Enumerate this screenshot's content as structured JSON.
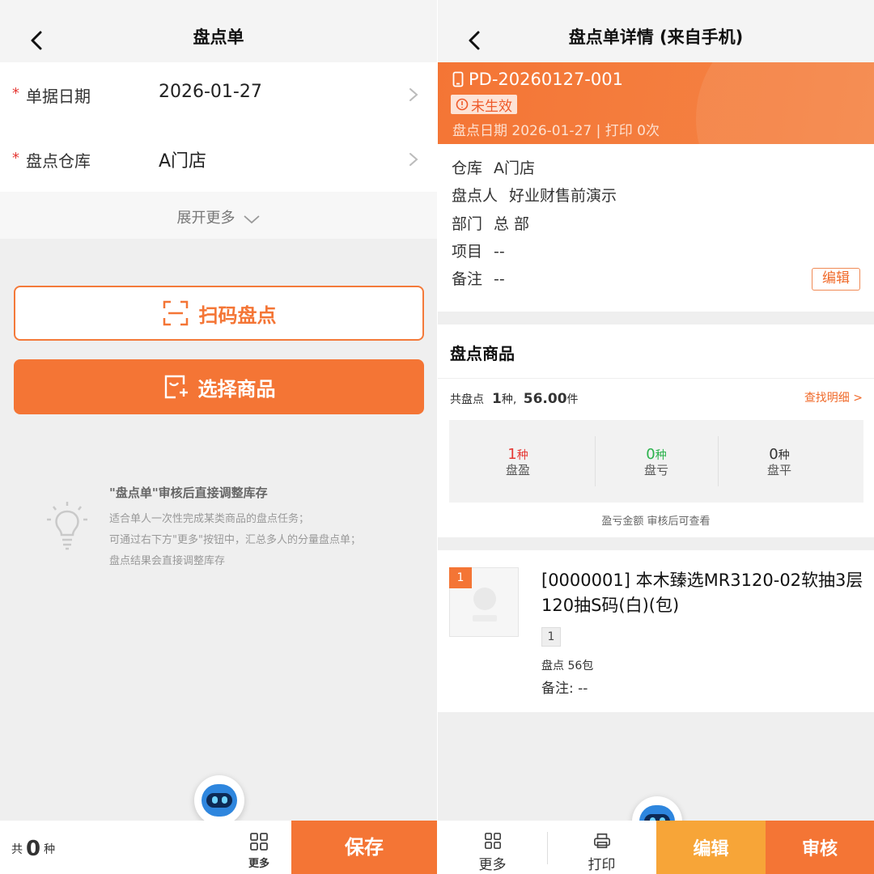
{
  "left": {
    "nav": {
      "title": "盘点单"
    },
    "form": {
      "date": {
        "required_mark": "*",
        "label": "单据日期",
        "value": "2026-01-27"
      },
      "warehouse": {
        "required_mark": "*",
        "label": "盘点仓库",
        "value": "A门店"
      }
    },
    "expand_label": "展开更多",
    "scan_button": "扫码盘点",
    "select_button": "选择商品",
    "tip": {
      "title": "\"盘点单\"审核后直接调整库存",
      "lines": [
        "适合单人一次性完成某类商品的盘点任务；",
        "可通过右下方\"更多\"按钮中，汇总多人的分量盘点单；",
        "盘点结果会直接调整库存"
      ]
    },
    "bottom": {
      "count_prefix": "共",
      "count": "0",
      "count_unit": "种",
      "more_label": "更多",
      "save_label": "保存"
    }
  },
  "right": {
    "nav": {
      "title": "盘点单详情 (来自手机)"
    },
    "header": {
      "doc_no": "PD-20260127-001",
      "status": "未生效",
      "meta": "盘点日期  2026-01-27 | 打印  0次"
    },
    "info": {
      "warehouse": {
        "label": "仓库",
        "value": "A门店"
      },
      "checker": {
        "label": "盘点人",
        "value": "好业财售前演示"
      },
      "department": {
        "label": "部门",
        "value": "总 部"
      },
      "project": {
        "label": "项目",
        "value": "--"
      },
      "remark": {
        "label": "备注",
        "value": "--"
      },
      "edit_label": "编辑"
    },
    "goods": {
      "title": "盘点商品",
      "summary_label": "共盘点",
      "summary_kinds": "1",
      "summary_kinds_unit": "种,",
      "summary_qty": "56.00",
      "summary_qty_unit": "件",
      "find_link": "查找明细 >",
      "stats": [
        {
          "value": "1",
          "unit": "种",
          "label": "盘盈",
          "color": "#e53935"
        },
        {
          "value": "0",
          "unit": "种",
          "label": "盘亏",
          "color": "#2bb24c"
        },
        {
          "value": "0",
          "unit": "种",
          "label": "盘平",
          "color": "#333333"
        }
      ],
      "note": "盈亏金额   审核后可查看"
    },
    "item": {
      "index": "1",
      "name": "[0000001] 本木臻选MR3120-02软抽3层120抽S码(白)(包)",
      "tag": "1",
      "qty": "盘点 56包",
      "remark": "备注:  --"
    },
    "bottom": {
      "more_label": "更多",
      "print_label": "打印",
      "edit_label": "编辑",
      "audit_label": "审核"
    }
  },
  "colors": {
    "accent": "#f47535",
    "accent_light": "#f7a538",
    "danger": "#e53935",
    "success": "#2bb24c"
  }
}
